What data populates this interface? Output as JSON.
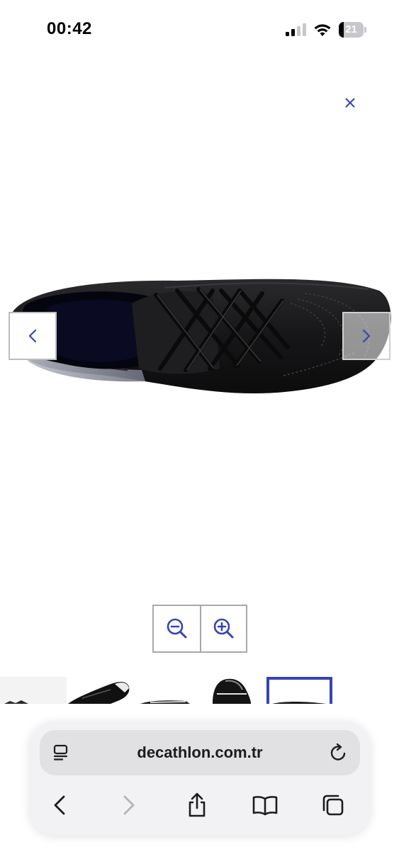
{
  "status_bar": {
    "time": "00:42",
    "battery_level": "21",
    "battery_fraction": 0.21
  },
  "viewer": {
    "close_icon": "close-icon",
    "prev_icon": "chevron-left-icon",
    "next_icon": "chevron-right-icon",
    "zoom_out_icon": "zoom-out-icon",
    "zoom_in_icon": "zoom-in-icon",
    "accent_color": "#3643ba",
    "thumbnails_count_visible": 5,
    "selected_thumbnail": 5
  },
  "browser": {
    "url": "decathlon.com.tr",
    "icons": [
      "reader-icon",
      "reload-icon",
      "back-icon",
      "forward-icon",
      "share-icon",
      "bookmarks-icon",
      "tabs-icon"
    ]
  }
}
